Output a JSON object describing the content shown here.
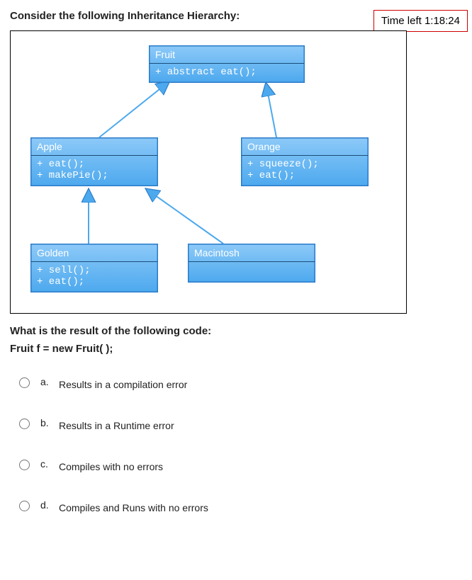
{
  "header": "Consider the following Inheritance Hierarchy:",
  "time_left": "Time left 1:18:24",
  "uml": {
    "fruit": {
      "name": "Fruit",
      "methods": [
        "+ abstract eat();"
      ]
    },
    "apple": {
      "name": "Apple",
      "methods": [
        "+ eat();",
        "+ makePie();"
      ]
    },
    "orange": {
      "name": "Orange",
      "methods": [
        "+ squeeze();",
        "+ eat();"
      ]
    },
    "golden": {
      "name": "Golden",
      "methods": [
        "+ sell();",
        "+ eat();"
      ]
    },
    "macintosh": {
      "name": "Macintosh",
      "methods": []
    }
  },
  "question": "What is the result of the following code:",
  "code": "Fruit  f  =  new  Fruit( );",
  "options": {
    "a": {
      "letter": "a.",
      "text": "Results in a compilation error"
    },
    "b": {
      "letter": "b.",
      "text": "Results in a Runtime error"
    },
    "c": {
      "letter": "c.",
      "text": "Compiles with no errors"
    },
    "d": {
      "letter": "d.",
      "text": "Compiles and Runs with no errors"
    }
  }
}
